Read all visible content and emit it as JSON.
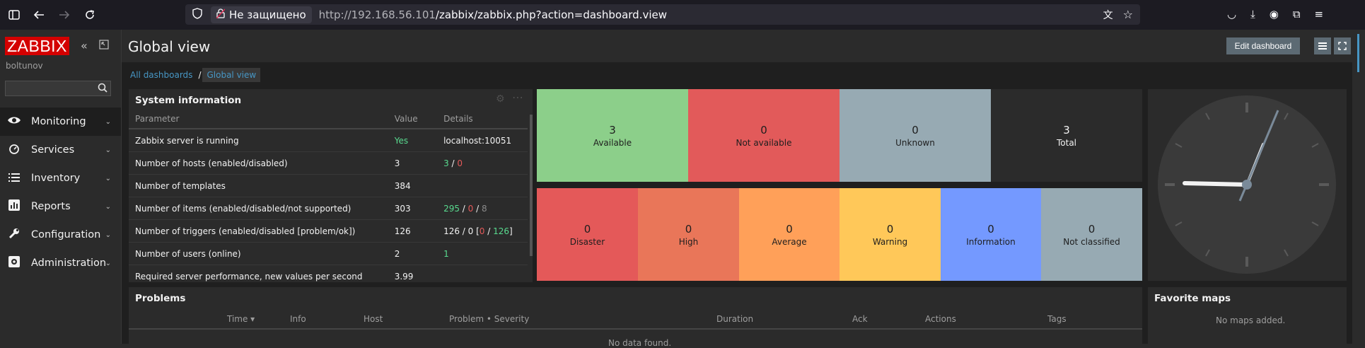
{
  "browser": {
    "security_text": "Не защищено",
    "url_host": "http://192.168.56.101",
    "url_path": "/zabbix/zabbix.php?action=dashboard.view"
  },
  "sidebar": {
    "logo": "ZABBIX",
    "username": "boltunov",
    "search_value": "",
    "menu": [
      {
        "label": "Monitoring",
        "icon": "eye-icon"
      },
      {
        "label": "Services",
        "icon": "stopwatch-icon"
      },
      {
        "label": "Inventory",
        "icon": "list-icon"
      },
      {
        "label": "Reports",
        "icon": "bar-chart-icon"
      },
      {
        "label": "Configuration",
        "icon": "wrench-icon"
      },
      {
        "label": "Administration",
        "icon": "gear-icon"
      }
    ]
  },
  "header": {
    "title": "Global view",
    "edit_label": "Edit dashboard"
  },
  "breadcrumb": {
    "all": "All dashboards",
    "separator": "/",
    "current": "Global view"
  },
  "system_info": {
    "title": "System information",
    "columns": [
      "Parameter",
      "Value",
      "Details"
    ],
    "rows": [
      {
        "param": "Zabbix server is running",
        "value": "Yes",
        "details": "localhost:10051"
      },
      {
        "param": "Number of hosts (enabled/disabled)",
        "value": "3",
        "d1": "3",
        "d2": "0"
      },
      {
        "param": "Number of templates",
        "value": "384"
      },
      {
        "param": "Number of items (enabled/disabled/not supported)",
        "value": "303",
        "d1": "295",
        "d2": "0",
        "d3": "8"
      },
      {
        "param": "Number of triggers (enabled/disabled [problem/ok])",
        "value": "126",
        "d0": "126 / 0 [",
        "d2": "0",
        "d3": "126",
        "d4": "]"
      },
      {
        "param": "Number of users (online)",
        "value": "2",
        "d1": "1"
      },
      {
        "param": "Required server performance, new values per second",
        "value": "3.99"
      }
    ]
  },
  "host_availability": [
    {
      "value": "3",
      "label": "Available",
      "color": "#8ccf8a"
    },
    {
      "value": "0",
      "label": "Not available",
      "color": "#e25a5a"
    },
    {
      "value": "0",
      "label": "Unknown",
      "color": "#97aab3"
    },
    {
      "value": "3",
      "label": "Total",
      "color": "#2b2b2b"
    }
  ],
  "problems_by_severity": [
    {
      "value": "0",
      "label": "Disaster",
      "color": "#e45959"
    },
    {
      "value": "0",
      "label": "High",
      "color": "#e97659"
    },
    {
      "value": "0",
      "label": "Average",
      "color": "#ffa059"
    },
    {
      "value": "0",
      "label": "Warning",
      "color": "#ffc859"
    },
    {
      "value": "0",
      "label": "Information",
      "color": "#7499ff"
    },
    {
      "value": "0",
      "label": "Not classified",
      "color": "#97aab3"
    }
  ],
  "problems": {
    "title": "Problems",
    "columns": [
      "Time ▾",
      "Info",
      "Host",
      "Problem • Severity",
      "Duration",
      "Ack",
      "Actions",
      "Tags"
    ],
    "empty": "No data found."
  },
  "favorite_maps": {
    "title": "Favorite maps",
    "empty": "No maps added."
  }
}
